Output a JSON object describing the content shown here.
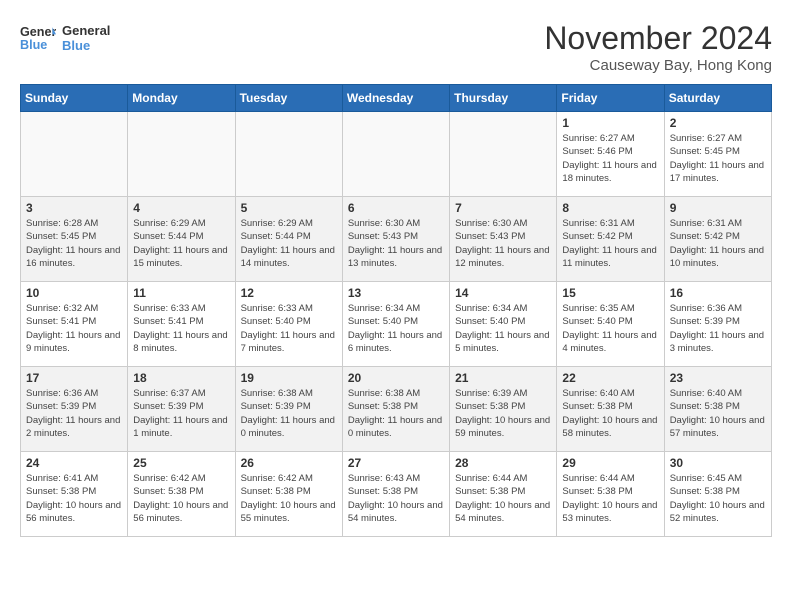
{
  "header": {
    "logo_text_general": "General",
    "logo_text_blue": "Blue",
    "month_title": "November 2024",
    "location": "Causeway Bay, Hong Kong"
  },
  "weekdays": [
    "Sunday",
    "Monday",
    "Tuesday",
    "Wednesday",
    "Thursday",
    "Friday",
    "Saturday"
  ],
  "weeks": [
    [
      {
        "day": "",
        "info": ""
      },
      {
        "day": "",
        "info": ""
      },
      {
        "day": "",
        "info": ""
      },
      {
        "day": "",
        "info": ""
      },
      {
        "day": "",
        "info": ""
      },
      {
        "day": "1",
        "info": "Sunrise: 6:27 AM\nSunset: 5:46 PM\nDaylight: 11 hours and 18 minutes."
      },
      {
        "day": "2",
        "info": "Sunrise: 6:27 AM\nSunset: 5:45 PM\nDaylight: 11 hours and 17 minutes."
      }
    ],
    [
      {
        "day": "3",
        "info": "Sunrise: 6:28 AM\nSunset: 5:45 PM\nDaylight: 11 hours and 16 minutes."
      },
      {
        "day": "4",
        "info": "Sunrise: 6:29 AM\nSunset: 5:44 PM\nDaylight: 11 hours and 15 minutes."
      },
      {
        "day": "5",
        "info": "Sunrise: 6:29 AM\nSunset: 5:44 PM\nDaylight: 11 hours and 14 minutes."
      },
      {
        "day": "6",
        "info": "Sunrise: 6:30 AM\nSunset: 5:43 PM\nDaylight: 11 hours and 13 minutes."
      },
      {
        "day": "7",
        "info": "Sunrise: 6:30 AM\nSunset: 5:43 PM\nDaylight: 11 hours and 12 minutes."
      },
      {
        "day": "8",
        "info": "Sunrise: 6:31 AM\nSunset: 5:42 PM\nDaylight: 11 hours and 11 minutes."
      },
      {
        "day": "9",
        "info": "Sunrise: 6:31 AM\nSunset: 5:42 PM\nDaylight: 11 hours and 10 minutes."
      }
    ],
    [
      {
        "day": "10",
        "info": "Sunrise: 6:32 AM\nSunset: 5:41 PM\nDaylight: 11 hours and 9 minutes."
      },
      {
        "day": "11",
        "info": "Sunrise: 6:33 AM\nSunset: 5:41 PM\nDaylight: 11 hours and 8 minutes."
      },
      {
        "day": "12",
        "info": "Sunrise: 6:33 AM\nSunset: 5:40 PM\nDaylight: 11 hours and 7 minutes."
      },
      {
        "day": "13",
        "info": "Sunrise: 6:34 AM\nSunset: 5:40 PM\nDaylight: 11 hours and 6 minutes."
      },
      {
        "day": "14",
        "info": "Sunrise: 6:34 AM\nSunset: 5:40 PM\nDaylight: 11 hours and 5 minutes."
      },
      {
        "day": "15",
        "info": "Sunrise: 6:35 AM\nSunset: 5:40 PM\nDaylight: 11 hours and 4 minutes."
      },
      {
        "day": "16",
        "info": "Sunrise: 6:36 AM\nSunset: 5:39 PM\nDaylight: 11 hours and 3 minutes."
      }
    ],
    [
      {
        "day": "17",
        "info": "Sunrise: 6:36 AM\nSunset: 5:39 PM\nDaylight: 11 hours and 2 minutes."
      },
      {
        "day": "18",
        "info": "Sunrise: 6:37 AM\nSunset: 5:39 PM\nDaylight: 11 hours and 1 minute."
      },
      {
        "day": "19",
        "info": "Sunrise: 6:38 AM\nSunset: 5:39 PM\nDaylight: 11 hours and 0 minutes."
      },
      {
        "day": "20",
        "info": "Sunrise: 6:38 AM\nSunset: 5:38 PM\nDaylight: 11 hours and 0 minutes."
      },
      {
        "day": "21",
        "info": "Sunrise: 6:39 AM\nSunset: 5:38 PM\nDaylight: 10 hours and 59 minutes."
      },
      {
        "day": "22",
        "info": "Sunrise: 6:40 AM\nSunset: 5:38 PM\nDaylight: 10 hours and 58 minutes."
      },
      {
        "day": "23",
        "info": "Sunrise: 6:40 AM\nSunset: 5:38 PM\nDaylight: 10 hours and 57 minutes."
      }
    ],
    [
      {
        "day": "24",
        "info": "Sunrise: 6:41 AM\nSunset: 5:38 PM\nDaylight: 10 hours and 56 minutes."
      },
      {
        "day": "25",
        "info": "Sunrise: 6:42 AM\nSunset: 5:38 PM\nDaylight: 10 hours and 56 minutes."
      },
      {
        "day": "26",
        "info": "Sunrise: 6:42 AM\nSunset: 5:38 PM\nDaylight: 10 hours and 55 minutes."
      },
      {
        "day": "27",
        "info": "Sunrise: 6:43 AM\nSunset: 5:38 PM\nDaylight: 10 hours and 54 minutes."
      },
      {
        "day": "28",
        "info": "Sunrise: 6:44 AM\nSunset: 5:38 PM\nDaylight: 10 hours and 54 minutes."
      },
      {
        "day": "29",
        "info": "Sunrise: 6:44 AM\nSunset: 5:38 PM\nDaylight: 10 hours and 53 minutes."
      },
      {
        "day": "30",
        "info": "Sunrise: 6:45 AM\nSunset: 5:38 PM\nDaylight: 10 hours and 52 minutes."
      }
    ]
  ]
}
